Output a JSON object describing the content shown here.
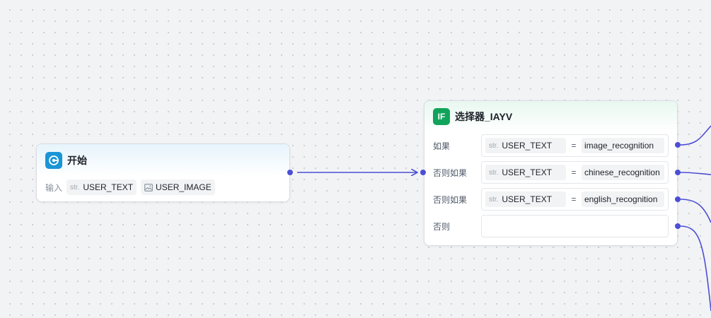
{
  "canvas": {
    "edge_color": "#4b4fd3",
    "dot_color": "#c9ccd3",
    "background": "#f2f3f5"
  },
  "start_node": {
    "icon": "start-icon",
    "icon_color": "#1a95d6",
    "title": "开始",
    "input_label": "输入",
    "inputs": [
      {
        "type": "str.",
        "name": "USER_TEXT"
      },
      {
        "type_icon": "image-icon",
        "name": "USER_IMAGE"
      }
    ]
  },
  "selector_node": {
    "icon_text": "IF",
    "icon_color": "#12a35b",
    "title": "选择器_IAYV",
    "conditions": [
      {
        "label": "如果",
        "var_type": "str.",
        "var": "USER_TEXT",
        "op": "=",
        "value": "image_recognition"
      },
      {
        "label": "否则如果",
        "var_type": "str.",
        "var": "USER_TEXT",
        "op": "=",
        "value": "chinese_recognition"
      },
      {
        "label": "否则如果",
        "var_type": "str.",
        "var": "USER_TEXT",
        "op": "=",
        "value": "english_recognition"
      },
      {
        "label": "否则"
      }
    ]
  }
}
